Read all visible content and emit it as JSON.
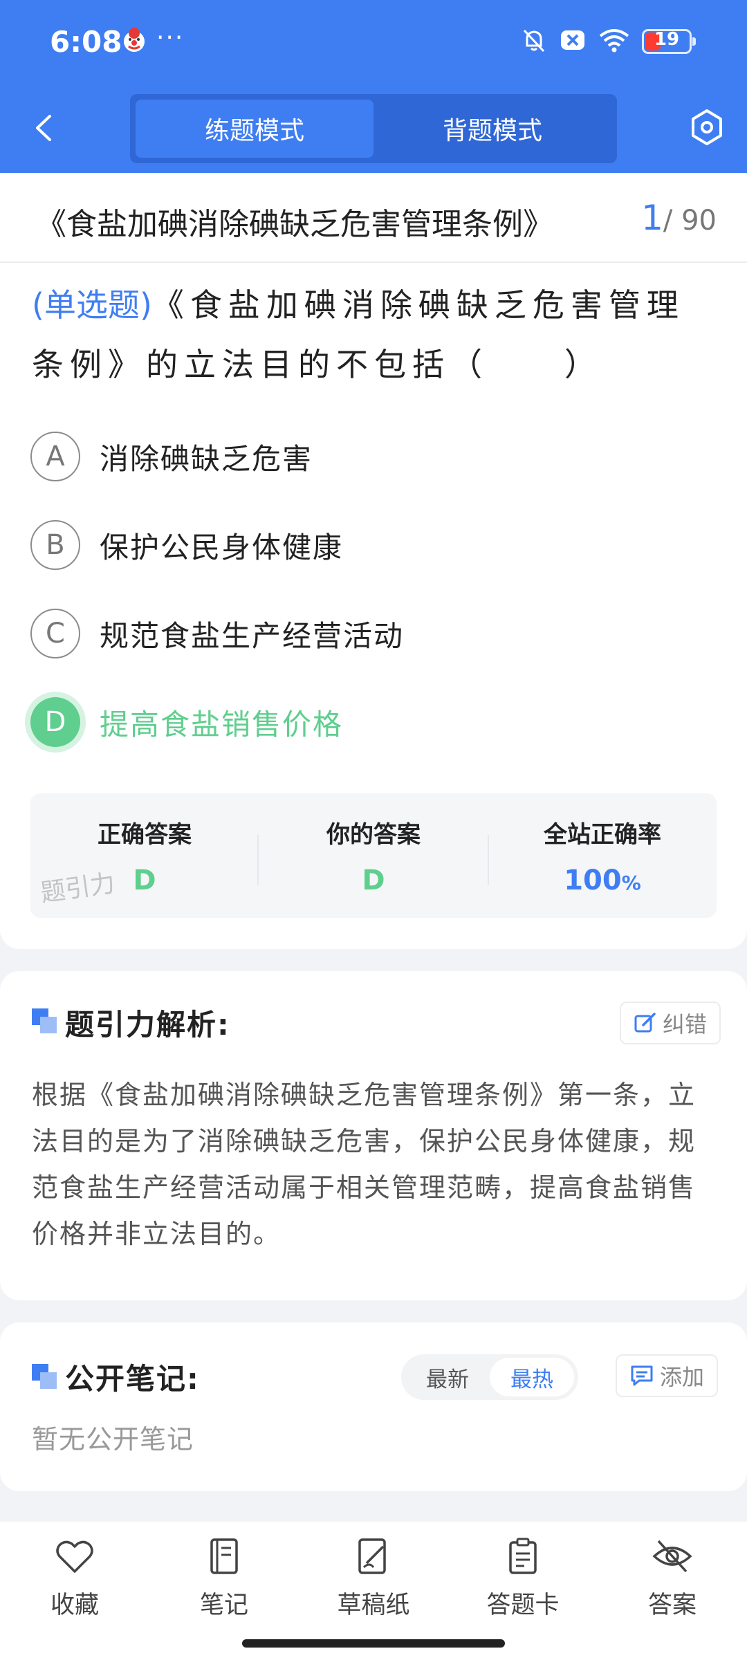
{
  "status_bar": {
    "time": "6:08",
    "more": "···",
    "battery": "19"
  },
  "header": {
    "tabs": [
      "练题模式",
      "背题模式"
    ],
    "active_tab": "练题模式",
    "accent_color": "#3f7ef2"
  },
  "exam": {
    "title": "《食盐加碘消除碘缺乏危害管理条例》",
    "current": "1",
    "total": "/ 90"
  },
  "question": {
    "type": "(单选题)",
    "text": "《食盐加碘消除碘缺乏危害管理条例》的立法目的不包括（　　）",
    "options": [
      {
        "letter": "A",
        "text": "消除碘缺乏危害"
      },
      {
        "letter": "B",
        "text": "保护公民身体健康"
      },
      {
        "letter": "C",
        "text": "规范食盐生产经营活动"
      },
      {
        "letter": "D",
        "text": "提高食盐销售价格",
        "state": "correct"
      }
    ]
  },
  "result": {
    "correct_label": "正确答案",
    "correct_value": "D",
    "yours_label": "你的答案",
    "yours_value": "D",
    "rate_label": "全站正确率",
    "rate_value": "100",
    "rate_unit": "%",
    "watermark": "题引力"
  },
  "analysis": {
    "title": "题引力解析:",
    "report_label": "纠错",
    "body": "根据《食盐加碘消除碘缺乏危害管理条例》第一条，立法目的是为了消除碘缺乏危害，保护公民身体健康，规范食盐生产经营活动属于相关管理范畴，提高食盐销售价格并非立法目的。"
  },
  "notes": {
    "title": "公开笔记:",
    "sort_options": [
      "最新",
      "最热"
    ],
    "active_sort": "最热",
    "add_label": "添加",
    "empty": "暂无公开笔记"
  },
  "bottom_nav": [
    {
      "label": "收藏",
      "icon": "heart-icon"
    },
    {
      "label": "笔记",
      "icon": "notebook-icon"
    },
    {
      "label": "草稿纸",
      "icon": "draft-icon"
    },
    {
      "label": "答题卡",
      "icon": "answer-card-icon"
    },
    {
      "label": "答案",
      "icon": "eye-off-icon"
    }
  ]
}
